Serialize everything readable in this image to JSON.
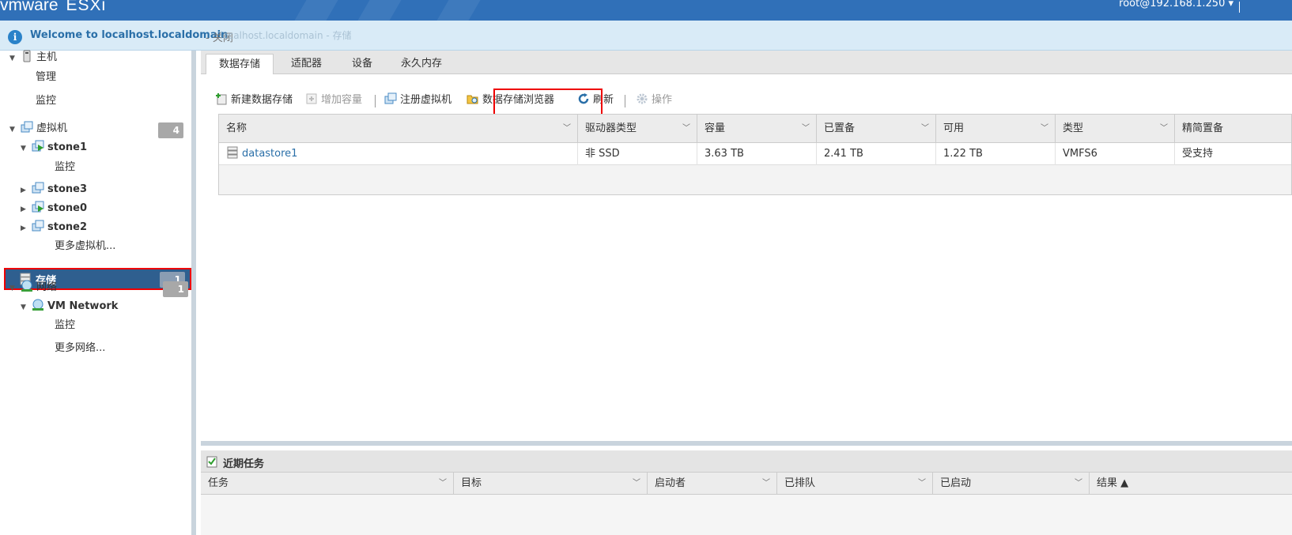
{
  "header": {
    "logo_brand": "vmware",
    "logo_product": "ESXi",
    "user": "root@192.168.1.250 ▾"
  },
  "info": {
    "message": "Welcome to localhost.localdomain",
    "close": "- 关闭",
    "ghost": "localhost.localdomain - 存储"
  },
  "sidebar": {
    "host": "主机",
    "manage": "管理",
    "monitor": "监控",
    "vms": "虚拟机",
    "vms_count": "4",
    "vm_items": [
      "stone1",
      "stone3",
      "stone0",
      "stone2"
    ],
    "vm_monitor": "监控",
    "more_vms": "更多虚拟机...",
    "storage": "存储",
    "storage_count": "1",
    "network": "网络",
    "network_count": "1",
    "vm_network": "VM Network",
    "net_monitor": "监控",
    "more_networks": "更多网络..."
  },
  "tabs": [
    "数据存储",
    "适配器",
    "设备",
    "永久内存"
  ],
  "toolbar": {
    "new_datastore": "新建数据存储",
    "increase_capacity": "增加容量",
    "register_vm": "注册虚拟机",
    "datastore_browser": "数据存储浏览器",
    "refresh": "刷新",
    "actions": "操作"
  },
  "table": {
    "columns": [
      "名称",
      "驱动器类型",
      "容量",
      "已置备",
      "可用",
      "类型",
      "精简置备"
    ],
    "rows": [
      [
        "datastore1",
        "非 SSD",
        "3.63 TB",
        "2.41 TB",
        "1.22 TB",
        "VMFS6",
        "受支持"
      ]
    ]
  },
  "tasks": {
    "title": "近期任务",
    "columns": [
      "任务",
      "目标",
      "启动者",
      "已排队",
      "已启动",
      "结果 ▲"
    ]
  },
  "colors": {
    "topbar": "#3070b8",
    "selected": "#2f5f8f",
    "highlight": "#e00000",
    "link": "#2a6fa8"
  }
}
